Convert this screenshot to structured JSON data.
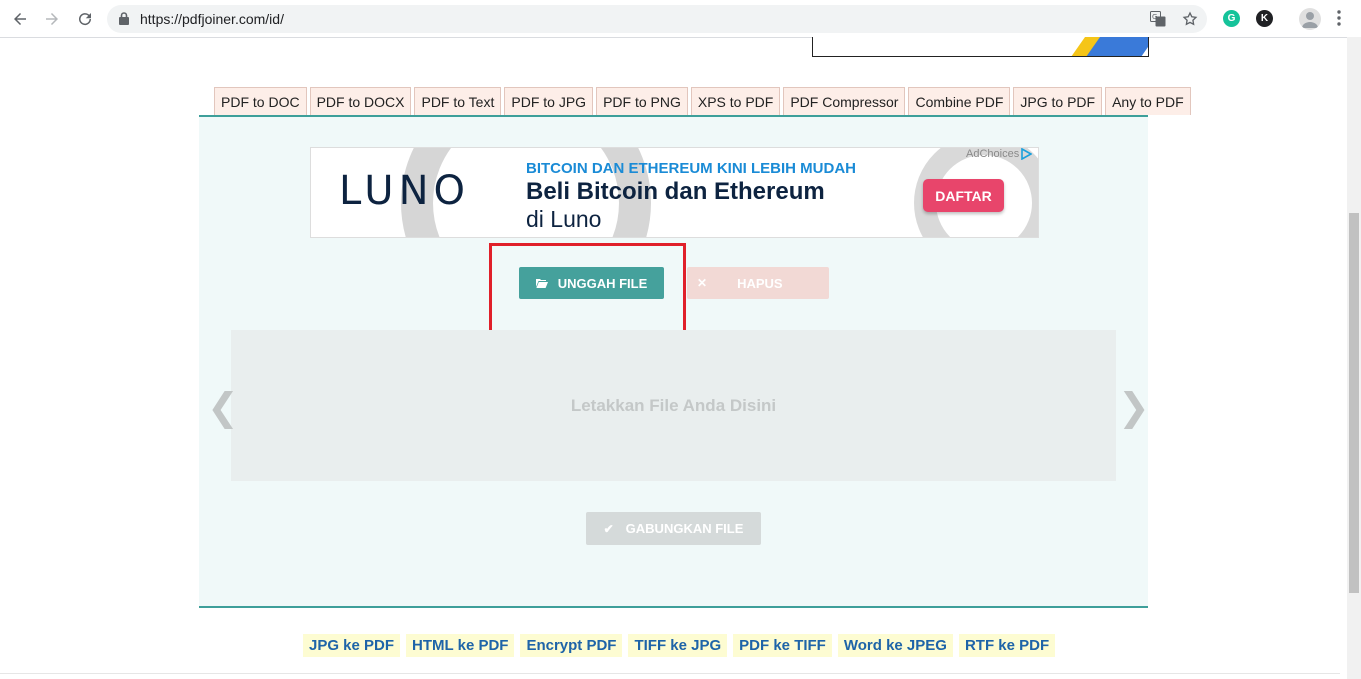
{
  "browser": {
    "url": "https://pdfjoiner.com/id/",
    "colors": {
      "grammarly": "#15c39a",
      "ext_k": "#202124"
    },
    "ext_k_label": "K"
  },
  "tabs": [
    "PDF to DOC",
    "PDF to DOCX",
    "PDF to Text",
    "PDF to JPG",
    "PDF to PNG",
    "XPS to PDF",
    "PDF Compressor",
    "Combine PDF",
    "JPG to PDF",
    "Any to PDF"
  ],
  "ad": {
    "brand": "LUNO",
    "headline_small": "BITCOIN DAN ETHEREUM KINI LEBIH MUDAH",
    "headline_big": "Beli Bitcoin dan Ethereum",
    "headline_sub": "di Luno",
    "cta": "DAFTAR",
    "adchoices": "AdChoices",
    "colors": {
      "brand": "#0d2340",
      "accent": "#1a8bd6",
      "cta": "#e8456b"
    }
  },
  "actions": {
    "upload": "UNGGAH FILE",
    "delete": "HAPUS",
    "merge": "GABUNGKAN FILE"
  },
  "dropzone": {
    "text": "Letakkan File Anda Disini",
    "prev_arrow": "❮",
    "next_arrow": "❯"
  },
  "bottom_links": [
    "JPG ke PDF",
    "HTML ke PDF",
    "Encrypt PDF",
    "TIFF ke JPG",
    "PDF ke TIFF",
    "Word ke JPEG",
    "RTF ke PDF"
  ],
  "colors": {
    "teal": "#45a19c",
    "highlight": "#e0202a",
    "link": "#1e64a8"
  }
}
